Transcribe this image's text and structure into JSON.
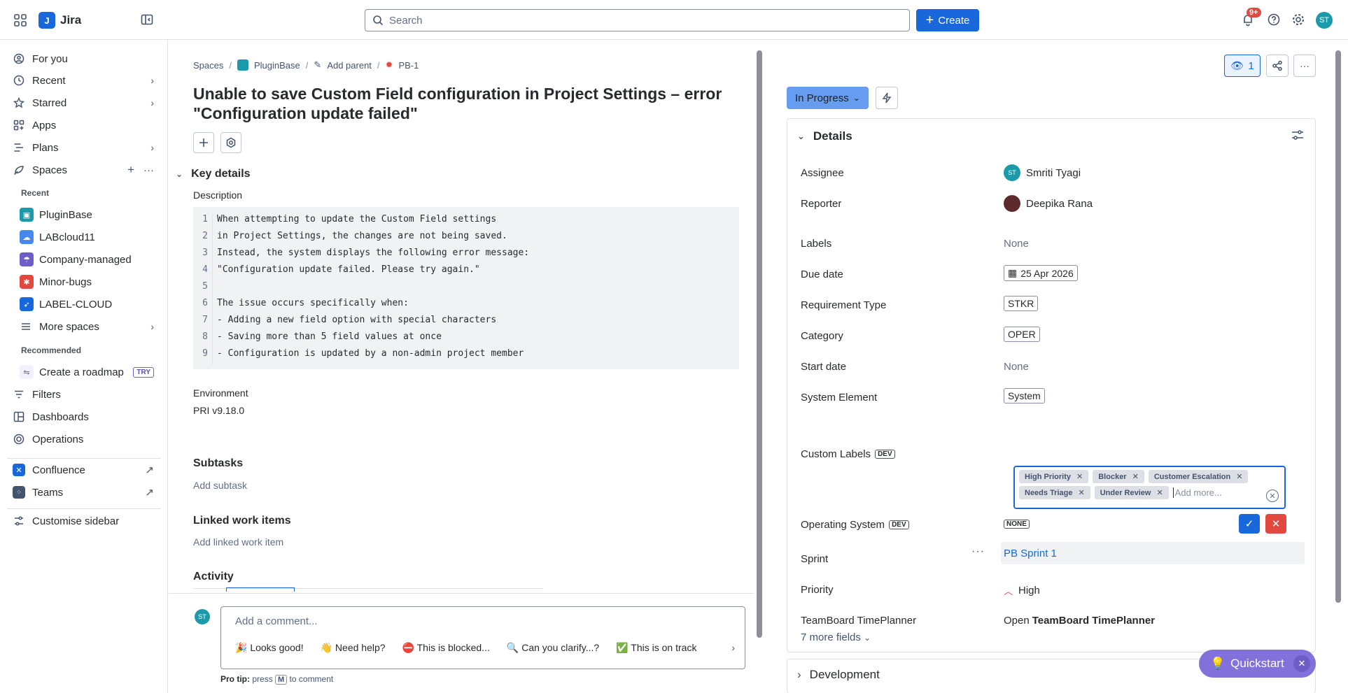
{
  "topbar": {
    "app_name": "Jira",
    "app_logo_letter": "J",
    "search_placeholder": "Search",
    "create_label": "Create",
    "notification_badge": "9+",
    "avatar_initials": "ST"
  },
  "sidebar": {
    "nav": [
      {
        "label": "For you"
      },
      {
        "label": "Recent"
      },
      {
        "label": "Starred"
      },
      {
        "label": "Apps"
      },
      {
        "label": "Plans"
      },
      {
        "label": "Spaces"
      }
    ],
    "recent_heading": "Recent",
    "recent_spaces": [
      {
        "label": "PluginBase",
        "color": "#1d9aaa"
      },
      {
        "label": "LABcloud11",
        "color": "#4688ec"
      },
      {
        "label": "Company-managed",
        "color": "#6e5dc6"
      },
      {
        "label": "Minor-bugs",
        "color": "#e2483d"
      },
      {
        "label": "LABEL-CLOUD",
        "color": "#1868db"
      }
    ],
    "more_spaces": "More spaces",
    "recommended_heading": "Recommended",
    "roadmap_label": "Create a roadmap",
    "try_badge": "TRY",
    "filters": "Filters",
    "dashboards": "Dashboards",
    "operations": "Operations",
    "confluence": "Confluence",
    "teams": "Teams",
    "customise": "Customise sidebar"
  },
  "breadcrumb": {
    "spaces": "Spaces",
    "project": "PluginBase",
    "add_parent": "Add parent",
    "issue_key": "PB-1"
  },
  "issue": {
    "title": "Unable to save Custom Field configuration in Project Settings – error \"Configuration update failed\"",
    "key_details": "Key details",
    "description_label": "Description",
    "description_lines": [
      {
        "n": "1",
        "text": "When attempting to update the Custom Field settings"
      },
      {
        "n": "2",
        "text": "in Project Settings, the changes are not being saved."
      },
      {
        "n": "3",
        "text": "Instead, the system displays the following error message:"
      },
      {
        "n": "4",
        "text": "\"Configuration update failed. Please try again.\""
      },
      {
        "n": "5",
        "text": ""
      },
      {
        "n": "6",
        "text": "The issue occurs specifically when:"
      },
      {
        "n": "7",
        "text": "- Adding a new field option with special characters"
      },
      {
        "n": "8",
        "text": "- Saving more than 5 field values at once"
      },
      {
        "n": "9",
        "text": "- Configuration is updated by a non-admin project member"
      }
    ],
    "environment_label": "Environment",
    "environment_value": "PRI v9.18.0",
    "subtasks_heading": "Subtasks",
    "add_subtask": "Add subtask",
    "linked_heading": "Linked work items",
    "add_linked": "Add linked work item",
    "activity_heading": "Activity"
  },
  "comment": {
    "avatar_initials": "ST",
    "placeholder": "Add a comment...",
    "chips": [
      "🎉 Looks good!",
      "👋 Need help?",
      "⛔ This is blocked...",
      "🔍 Can you clarify...?",
      "✅ This is on track"
    ],
    "pro_tip_label": "Pro tip:",
    "pro_tip_press": "press",
    "pro_tip_key": "M",
    "pro_tip_rest": "to comment"
  },
  "right": {
    "watch_count": "1",
    "status": "In Progress",
    "details_heading": "Details",
    "fields": {
      "assignee_label": "Assignee",
      "assignee_value": "Smriti Tyagi",
      "assignee_initials": "ST",
      "reporter_label": "Reporter",
      "reporter_value": "Deepika Rana",
      "labels_label": "Labels",
      "labels_value": "None",
      "due_label": "Due date",
      "due_value": "25 Apr 2026",
      "req_label": "Requirement Type",
      "req_value": "STKR",
      "category_label": "Category",
      "category_value": "OPER",
      "start_label": "Start date",
      "start_value": "None",
      "sys_label": "System Element",
      "sys_value": "System",
      "custom_label": "Custom Labels",
      "dev_badge": "DEV",
      "custom_tags_row1": [
        "High Priority",
        "Blocker",
        "Customer Escalation"
      ],
      "custom_tags_row2": [
        "Needs Triage",
        "Under Review"
      ],
      "add_more_placeholder": "Add more...",
      "os_label": "Operating System",
      "os_value": "NONE",
      "sprint_label": "Sprint",
      "sprint_value": "PB Sprint 1",
      "priority_label": "Priority",
      "priority_value": "High",
      "teamboard_label": "TeamBoard TimePlanner",
      "teamboard_open": "Open",
      "teamboard_value": "TeamBoard TimePlanner"
    },
    "more_fields": "7 more fields",
    "development_heading": "Development",
    "quickstart": "Quickstart"
  },
  "colors": {
    "brand": "#1868db",
    "status": "#669df1",
    "confirm": "#1868db",
    "cancel": "#e2483d",
    "quickstart": "#8270db"
  }
}
